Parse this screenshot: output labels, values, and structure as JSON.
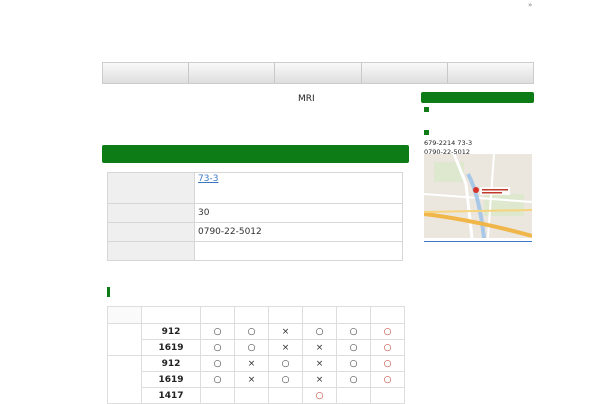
{
  "corner": {
    "mark": "»"
  },
  "nav": {
    "items": [
      "",
      "",
      "",
      "",
      ""
    ]
  },
  "main": {
    "title": "MRI",
    "info": {
      "rows": [
        {
          "label": "",
          "value": "73-3",
          "link": true
        },
        {
          "label": "",
          "value": "30"
        },
        {
          "label": "",
          "value": "0790-22-5012"
        },
        {
          "label": "",
          "value": ""
        }
      ]
    },
    "schedule": {
      "rows": [
        {
          "time": "912",
          "marks": [
            "○",
            "○",
            "×",
            "○",
            "○",
            "○"
          ]
        },
        {
          "time": "1619",
          "marks": [
            "○",
            "○",
            "×",
            "×",
            "○",
            "○"
          ]
        },
        {
          "time": "912",
          "marks": [
            "○",
            "×",
            "○",
            "×",
            "○",
            "○"
          ]
        },
        {
          "time": "1619",
          "marks": [
            "○",
            "×",
            "○",
            "×",
            "○",
            "○"
          ]
        },
        {
          "time": "1417",
          "marks": [
            "",
            "",
            "",
            "○",
            "",
            ""
          ]
        }
      ]
    }
  },
  "sidebar": {
    "address_line1": "679-2214 73-3",
    "address_line2": "0790-22-5012"
  },
  "colors": {
    "accent": "#0e7c16",
    "link": "#3a78c2",
    "mark_red": "#c0392b"
  }
}
